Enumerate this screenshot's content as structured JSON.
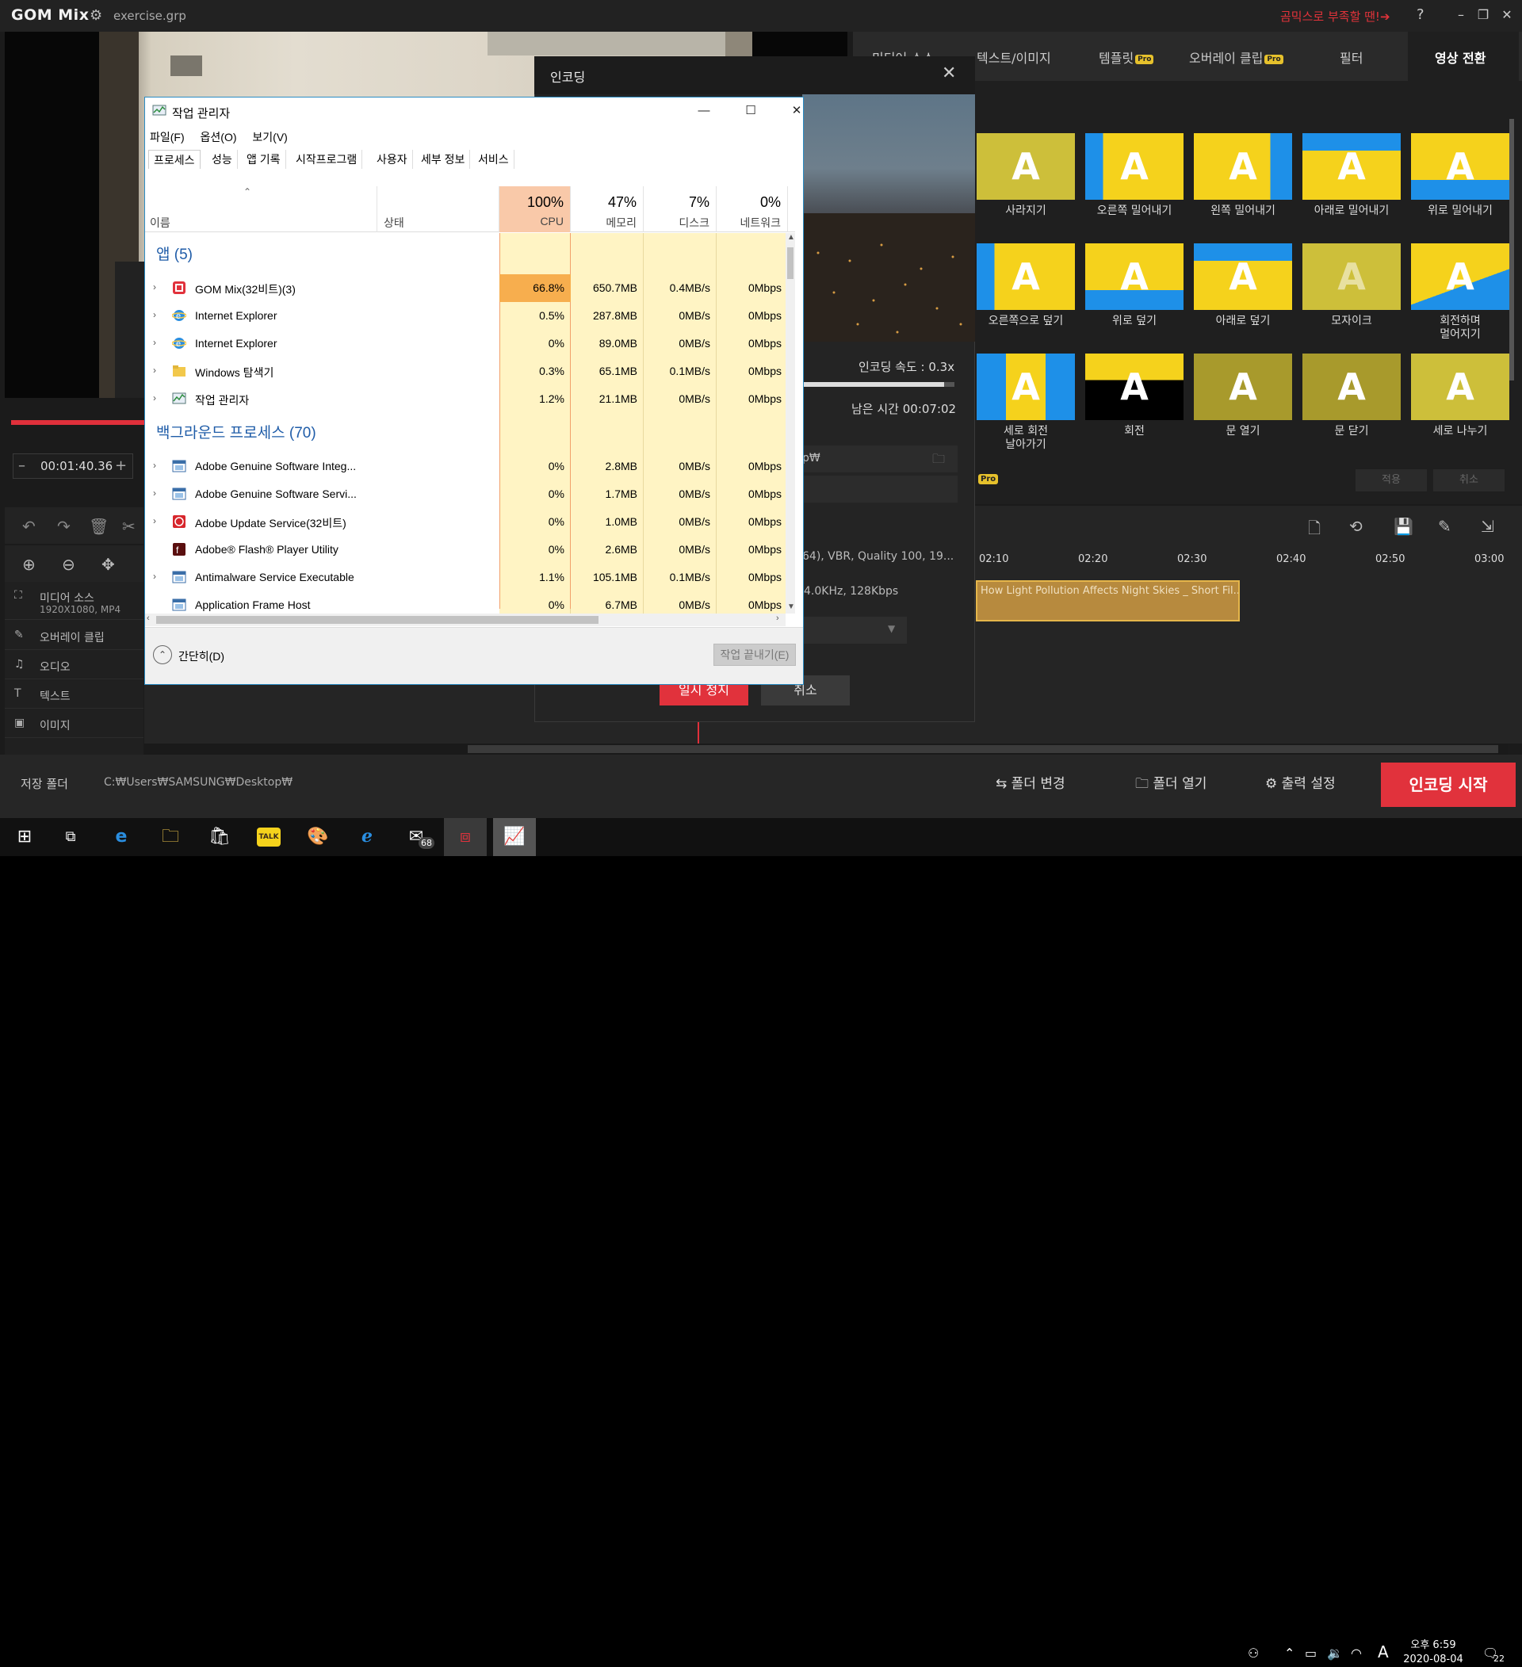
{
  "app": {
    "logo": "GOM Mix",
    "filename": "exercise.grp",
    "promo": "곰믹스로 부족할 땐!➔",
    "help": "?",
    "win_min": "–",
    "win_restore": "❐",
    "win_close": "✕"
  },
  "preview": {
    "timecode": "00:01:40.36",
    "minus": "–",
    "plus": "+"
  },
  "tracks": [
    {
      "label": "미디어 소스",
      "sub": "1920X1080, MP4"
    },
    {
      "label": "오버레이 클립"
    },
    {
      "label": "오디오"
    },
    {
      "label": "텍스트"
    },
    {
      "label": "이미지"
    }
  ],
  "right_tabs": [
    {
      "label": "미디어 소스",
      "pro": false
    },
    {
      "label": "텍스트/이미지",
      "pro": false
    },
    {
      "label": "템플릿",
      "pro": true
    },
    {
      "label": "오버레이 클립",
      "pro": true
    },
    {
      "label": "필터",
      "pro": false
    },
    {
      "label": "영상 전환",
      "pro": false
    }
  ],
  "pro_badge": "Pro",
  "transitions": [
    "사라지기",
    "오른쪽 밀어내기",
    "왼쪽 밀어내기",
    "아래로 밀어내기",
    "위로 밀어내기",
    "오른쪽으로 덮기",
    "위로 덮기",
    "아래로 덮기",
    "모자이크",
    "회전하며\n멀어지기",
    "세로 회전\n날아가기",
    "회전",
    "문 열기",
    "문 닫기",
    "세로 나누기"
  ],
  "transition_buttons": {
    "apply": "적용",
    "cancel": "취소"
  },
  "timeline": {
    "ticks": [
      "02:10",
      "02:20",
      "02:30",
      "02:40",
      "02:50",
      "03:00"
    ],
    "clip_label": "How Light Pollution Affects Night Skies _ Short Fil..."
  },
  "bottom": {
    "save_folder_label": "저장 폴더",
    "save_folder_path": "C:₩Users₩SAMSUNG₩Desktop₩",
    "change_folder": "폴더 변경",
    "open_folder": "폴더 열기",
    "output_settings": "출력 설정",
    "encode_start": "인코딩 시작"
  },
  "encoding": {
    "title": "인코딩",
    "speed": "인코딩 속도 : 0.3x",
    "remaining": "남은 시간 00:07:02",
    "progress": 0.93,
    "path_fragment": "p₩",
    "pro": "Pro",
    "info1": "64), VBR, Quality 100, 19...",
    "info2": "4.0KHz, 128Kbps",
    "pause": "일시 정지",
    "cancel": "취소"
  },
  "task_manager": {
    "title": "작업 관리자",
    "menu": [
      "파일(F)",
      "옵션(O)",
      "보기(V)"
    ],
    "tabs": [
      "프로세스",
      "성능",
      "앱 기록",
      "시작프로그램",
      "사용자",
      "세부 정보",
      "서비스"
    ],
    "columns": {
      "name": "이름",
      "status": "상태",
      "cpu_pct": "100%",
      "cpu": "CPU",
      "mem_pct": "47%",
      "mem": "메모리",
      "disk_pct": "7%",
      "disk": "디스크",
      "net_pct": "0%",
      "net": "네트워크"
    },
    "apps_group": "앱 (5)",
    "apps": [
      {
        "name": "GOM Mix(32비트)(3)",
        "cpu": "66.8%",
        "mem": "650.7MB",
        "disk": "0.4MB/s",
        "net": "0Mbps",
        "icon": "gom"
      },
      {
        "name": "Internet Explorer",
        "cpu": "0.5%",
        "mem": "287.8MB",
        "disk": "0MB/s",
        "net": "0Mbps",
        "icon": "ie"
      },
      {
        "name": "Internet Explorer",
        "cpu": "0%",
        "mem": "89.0MB",
        "disk": "0MB/s",
        "net": "0Mbps",
        "icon": "ie"
      },
      {
        "name": "Windows 탐색기",
        "cpu": "0.3%",
        "mem": "65.1MB",
        "disk": "0.1MB/s",
        "net": "0Mbps",
        "icon": "folder"
      },
      {
        "name": "작업 관리자",
        "cpu": "1.2%",
        "mem": "21.1MB",
        "disk": "0MB/s",
        "net": "0Mbps",
        "icon": "tm"
      }
    ],
    "bg_group": "백그라운드 프로세스 (70)",
    "bg": [
      {
        "name": "Adobe Genuine Software Integ...",
        "cpu": "0%",
        "mem": "2.8MB",
        "disk": "0MB/s",
        "net": "0Mbps",
        "icon": "win",
        "chev": true
      },
      {
        "name": "Adobe Genuine Software Servi...",
        "cpu": "0%",
        "mem": "1.7MB",
        "disk": "0MB/s",
        "net": "0Mbps",
        "icon": "win",
        "chev": true
      },
      {
        "name": "Adobe Update Service(32비트)",
        "cpu": "0%",
        "mem": "1.0MB",
        "disk": "0MB/s",
        "net": "0Mbps",
        "icon": "adobe",
        "chev": true
      },
      {
        "name": "Adobe® Flash® Player Utility",
        "cpu": "0%",
        "mem": "2.6MB",
        "disk": "0MB/s",
        "net": "0Mbps",
        "icon": "flash",
        "chev": false
      },
      {
        "name": "Antimalware Service Executable",
        "cpu": "1.1%",
        "mem": "105.1MB",
        "disk": "0.1MB/s",
        "net": "0Mbps",
        "icon": "win",
        "chev": true
      },
      {
        "name": "Application Frame Host",
        "cpu": "0%",
        "mem": "6.7MB",
        "disk": "0MB/s",
        "net": "0Mbps",
        "icon": "win",
        "chev": false
      }
    ],
    "fewer_details": "간단히(D)",
    "end_task": "작업 끝내기(E)",
    "colors": {
      "cpu_header": "#f9c9a9",
      "cpu_hot": "#f7ae4e",
      "heat": "#fff4c4",
      "group": "#1f5ca8"
    }
  },
  "taskbar": {
    "mail_badge": "68",
    "time": "오후 6:59",
    "date": "2020-08-04",
    "ime": "A",
    "notif": "22"
  },
  "colors": {
    "accent": "#e1323c",
    "transition_yellow": "#f5d21c",
    "transition_blue": "#1e90e8"
  }
}
